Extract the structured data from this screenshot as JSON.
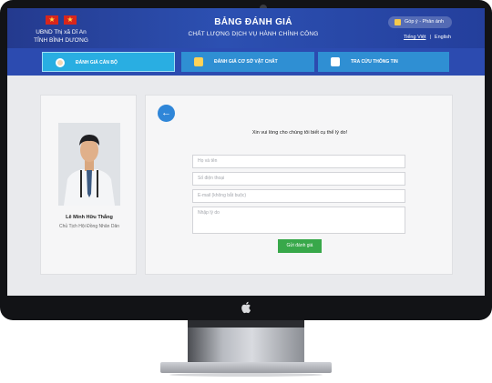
{
  "header": {
    "org_line1": "UBND Thị xã Dĩ An",
    "org_line2": "TỈNH BÌNH DƯƠNG",
    "title": "BẢNG ĐÁNH GIÁ",
    "subtitle": "CHẤT LƯỢNG DỊCH VỤ HÀNH CHÍNH CÔNG",
    "feedback_label": "Góp ý - Phản ánh",
    "languages": [
      "Tiếng Việt",
      "English"
    ],
    "flags": [
      "vietnam-flag",
      "vietnam-flag"
    ]
  },
  "tabs": [
    {
      "label": "ĐÁNH GIÁ CÁN BỘ",
      "icon": "person-icon",
      "active": true
    },
    {
      "label": "ĐÁNH GIÁ CƠ SỞ VẬT CHẤT",
      "icon": "thumbs-up-icon",
      "active": false
    },
    {
      "label": "TRA CỨU THÔNG TIN",
      "icon": "document-icon",
      "active": false
    }
  ],
  "profile": {
    "name": "Lê Minh Hữu Thắng",
    "role": "Chủ Tịch Hội Đồng Nhân Dân"
  },
  "form": {
    "prompt": "Xin vui lòng cho chúng tôi biết cụ thể lý do!",
    "fields": [
      {
        "placeholder": "Họ và tên"
      },
      {
        "placeholder": "Số điện thoại"
      },
      {
        "placeholder": "E-mail (không bắt buộc)"
      }
    ],
    "textarea_placeholder": "Nhập lý do",
    "submit_label": "Gửi đánh giá",
    "back_icon": "arrow-left-icon"
  },
  "colors": {
    "header_bg": "#2a47a8",
    "tab_active": "#29aee2",
    "tab_default": "#2f8fd3",
    "submit": "#38a84a",
    "back_button": "#2f86d8"
  }
}
